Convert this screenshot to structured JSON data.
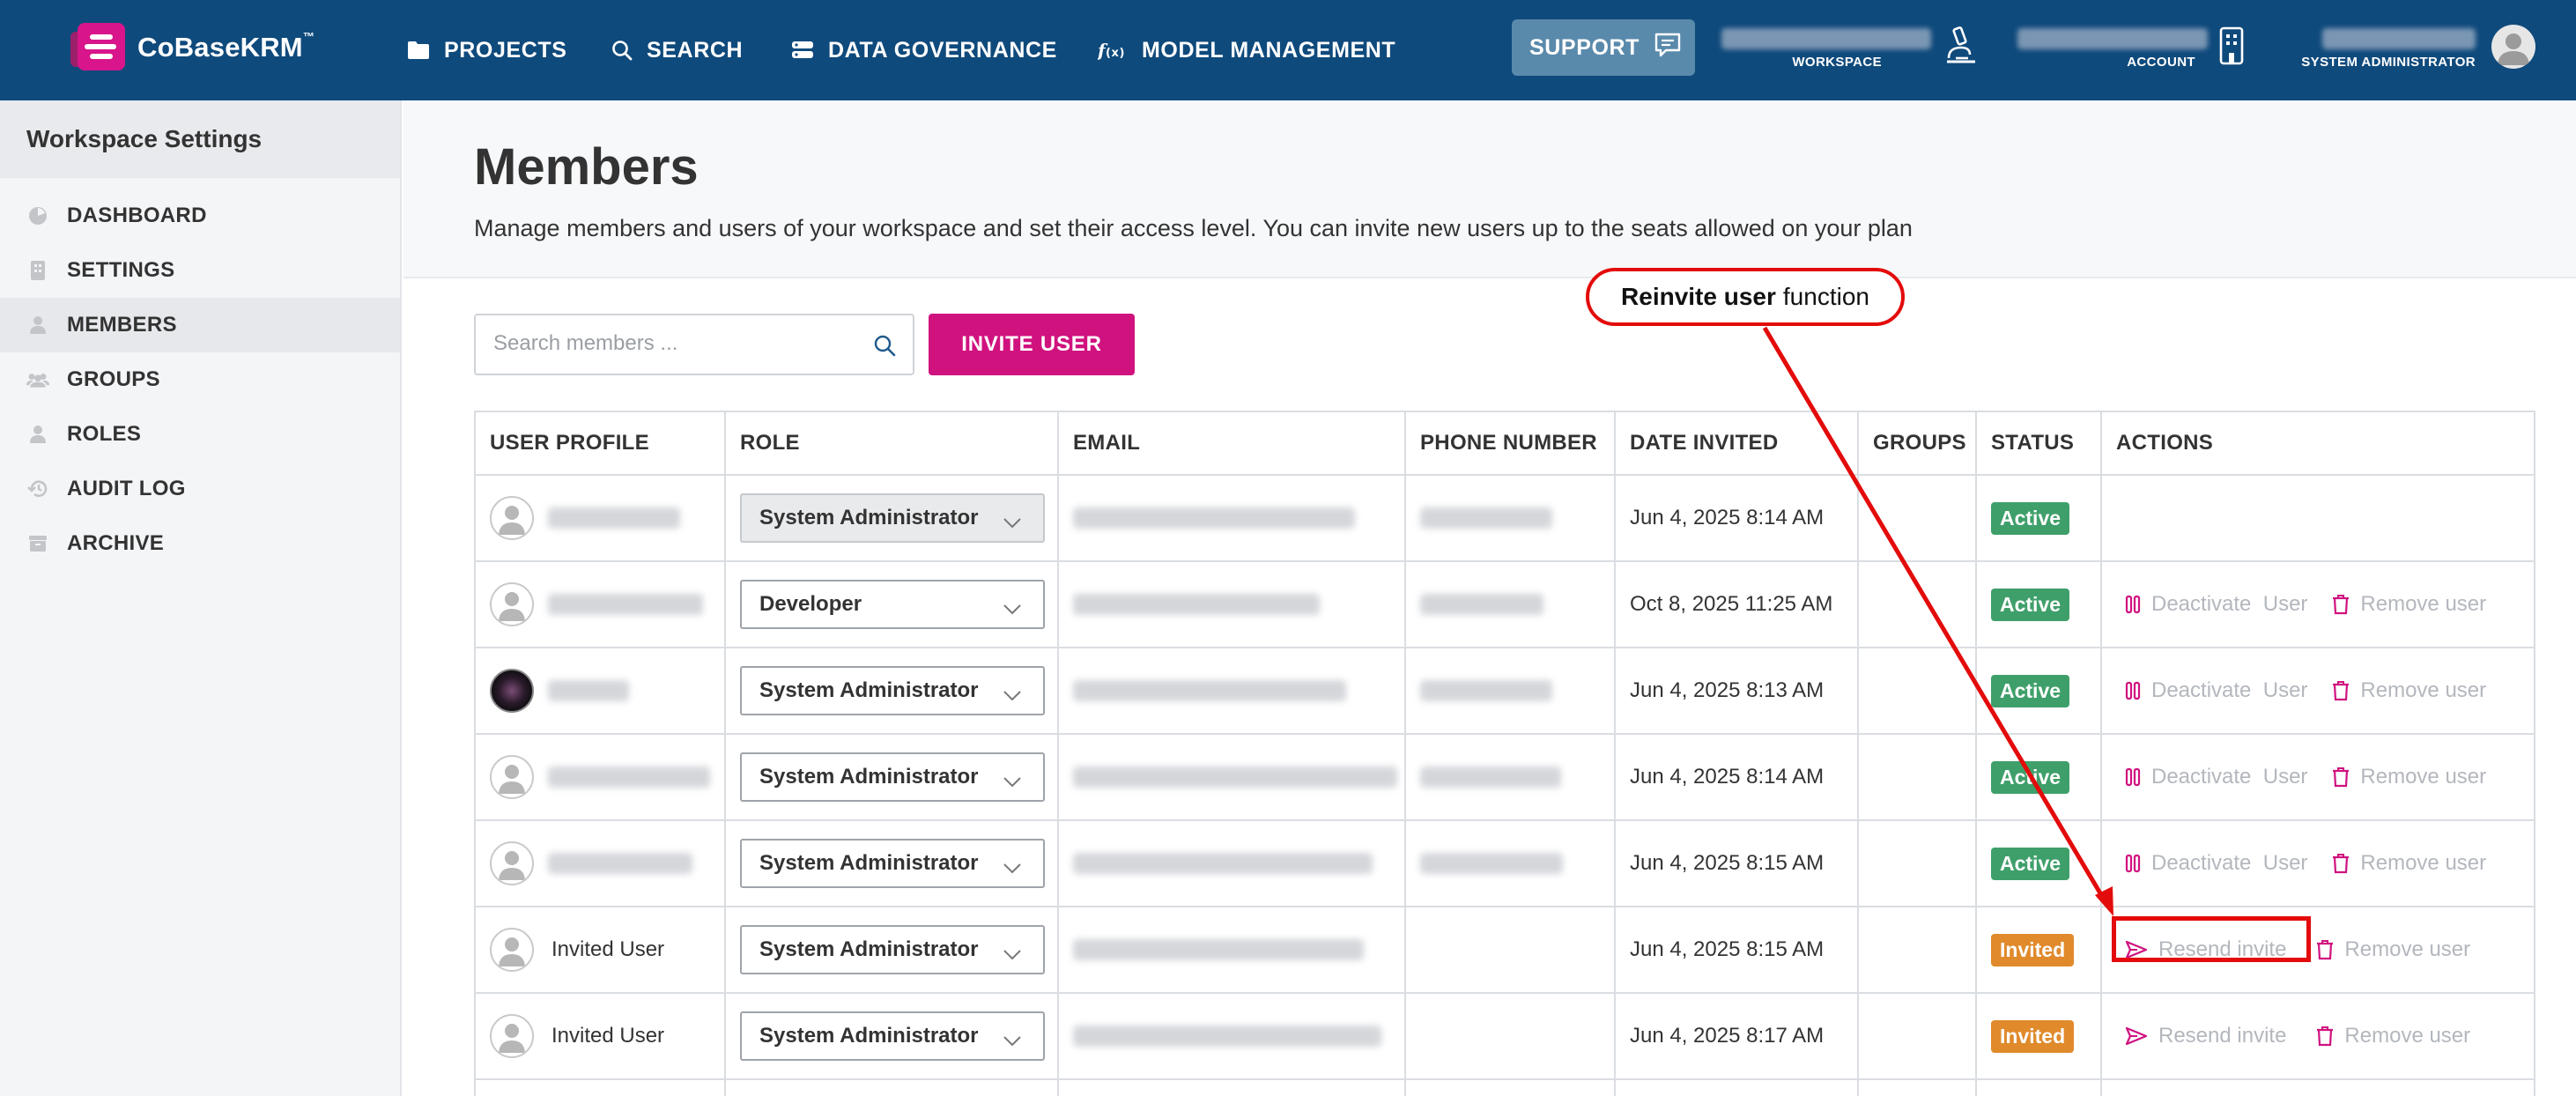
{
  "header": {
    "logo_text": "CoBaseKRM",
    "logo_tm": "™",
    "nav": [
      {
        "label": "PROJECTS",
        "icon": "folder-icon"
      },
      {
        "label": "SEARCH",
        "icon": "search-icon"
      },
      {
        "label": "DATA GOVERNANCE",
        "icon": "database-icon"
      },
      {
        "label": "MODEL MANAGEMENT",
        "icon": "function-icon"
      }
    ],
    "support_label": "SUPPORT",
    "workspace_label": "WORKSPACE",
    "account_label": "ACCOUNT",
    "user_label": "SYSTEM ADMINISTRATOR"
  },
  "sidebar": {
    "title": "Workspace Settings",
    "items": [
      {
        "label": "DASHBOARD",
        "icon": "dashboard-icon"
      },
      {
        "label": "SETTINGS",
        "icon": "building-icon"
      },
      {
        "label": "MEMBERS",
        "icon": "person-icon",
        "active": true
      },
      {
        "label": "GROUPS",
        "icon": "group-icon"
      },
      {
        "label": "ROLES",
        "icon": "person-icon"
      },
      {
        "label": "AUDIT LOG",
        "icon": "history-icon"
      },
      {
        "label": "ARCHIVE",
        "icon": "archive-icon"
      }
    ]
  },
  "main": {
    "title": "Members",
    "subtitle": "Manage members and users of your workspace and set their access level. You can invite new users up to the seats allowed on your plan",
    "search_placeholder": "Search members ...",
    "invite_button": "INVITE USER"
  },
  "table": {
    "columns": [
      "USER PROFILE",
      "ROLE",
      "EMAIL",
      "PHONE NUMBER",
      "DATE INVITED",
      "GROUPS",
      "STATUS",
      "ACTIONS"
    ],
    "rows": [
      {
        "name": "",
        "role": "System Administrator",
        "date": "Jun 4, 2025 8:14 AM",
        "status": "Active"
      },
      {
        "name": "",
        "role": "Developer",
        "date": "Oct 8, 2025 11:25 AM",
        "status": "Active"
      },
      {
        "name": "",
        "role": "System Administrator",
        "date": "Jun 4, 2025 8:13 AM",
        "status": "Active"
      },
      {
        "name": "",
        "role": "System Administrator",
        "date": "Jun 4, 2025 8:14 AM",
        "status": "Active"
      },
      {
        "name": "",
        "role": "System Administrator",
        "date": "Jun 4, 2025 8:15 AM",
        "status": "Active"
      },
      {
        "name": "Invited User",
        "role": "System Administrator",
        "date": "Jun 4, 2025 8:15 AM",
        "status": "Invited"
      },
      {
        "name": "Invited User",
        "role": "System Administrator",
        "date": "Jun 4, 2025 8:17 AM",
        "status": "Invited"
      }
    ],
    "actions": {
      "deactivate": "Deactivate",
      "deactivate_user": "User",
      "remove": "Remove user",
      "resend": "Resend invite"
    }
  },
  "annotation": {
    "bold": "Reinvite user",
    "rest": "function"
  },
  "colors": {
    "topbar": "#0f4a7c",
    "accent": "#d0127f",
    "active": "#3f9f6a",
    "invited": "#e08a2c",
    "annotation": "#e30b0b"
  }
}
